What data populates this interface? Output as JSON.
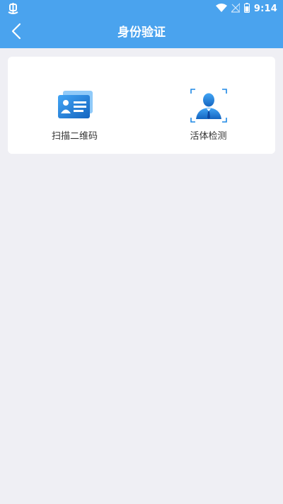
{
  "status_bar": {
    "time": "9:14",
    "icons": [
      "bug-icon",
      "wifi-icon",
      "signal-off-icon",
      "battery-icon"
    ]
  },
  "nav": {
    "title": "身份验证",
    "back_icon": "chevron-left-icon"
  },
  "options": [
    {
      "label": "扫描二维码",
      "icon": "id-card-icon"
    },
    {
      "label": "活体检测",
      "icon": "face-scan-icon"
    }
  ],
  "colors": {
    "primary": "#4AA3EE",
    "background": "#EFEFF4",
    "card": "#FFFFFF",
    "icon_blue": "#1E88E5",
    "text": "#333333"
  }
}
